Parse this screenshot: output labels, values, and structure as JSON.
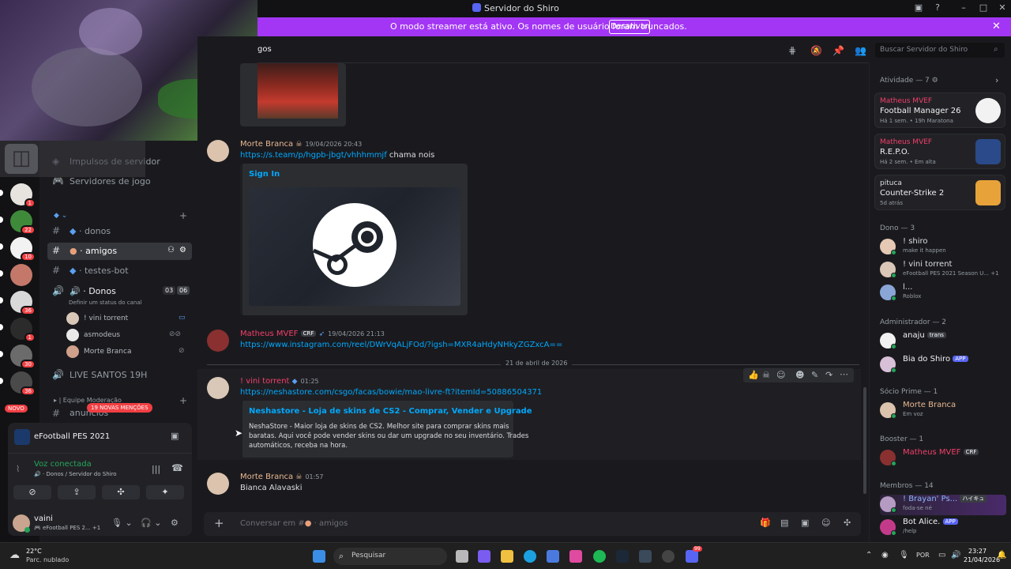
{
  "window": {
    "title": "Servidor do Shiro"
  },
  "streamer_banner": {
    "message": "O modo streamer está ativo. Os nomes de usuário foram truncados.",
    "button": "Desativar"
  },
  "server_rail": {
    "badges": [
      "1",
      "22",
      "10",
      "",
      "36",
      "1",
      "30",
      "36"
    ],
    "novo_label": "NOVO",
    "mentions_label": "19 NOVAS MENÇÕES"
  },
  "sidebar": {
    "top_items": [
      "Impulsos de servidor",
      "Servidores de jogo"
    ],
    "channels": [
      {
        "label": "donos",
        "prefix": "·"
      },
      {
        "label": "amigos",
        "prefix": "·"
      },
      {
        "label": "testes-bot",
        "prefix": "·"
      }
    ],
    "voice_channel": {
      "label": "Donos",
      "count_a": "03",
      "count_b": "06",
      "status_hint": "Definir um status do canal"
    },
    "voice_users": [
      "! vini torrent",
      "asmodeus",
      "Morte Branca"
    ],
    "other_channels": [
      "LIVE SANTOS 19H",
      "| Equipe Moderação",
      "anuncios"
    ]
  },
  "voice_panel": {
    "game": "eFootball PES 2021",
    "status": "Voz conectada",
    "location": "Donos / Servidor do Shiro",
    "user_name": "vaini",
    "user_activity": "eFootball PES 2...",
    "user_activity_extra": "+1"
  },
  "header": {
    "channel": "gos",
    "search_placeholder": "Buscar Servidor do Shiro"
  },
  "messages": [
    {
      "author": "Morte Branca",
      "time": "19/04/2026 20:43",
      "link": "https://s.team/p/hgpb-jbgt/vhhhmmjf",
      "text": " chama nois",
      "embed_title": "Sign In"
    },
    {
      "author": "Matheus MVEF",
      "tag": "CRF",
      "time": "19/04/2026 21:13",
      "link": "https://www.instagram.com/reel/DWrVqALjFOd/?igsh=MXR4aHdyNHkyZGZxcA=="
    },
    {
      "author": "! vini torrent",
      "time": "01:25",
      "link": "https://neshastore.com/csgo/facas/bowie/mao-livre-ft?itemId=50886504371",
      "embed_title": "Neshastore - Loja de skins de CS2 - Comprar, Vender e Upgrade",
      "embed_desc": [
        "NeshaStore - Maior loja de skins de CS2. Melhor site para comprar skins mais",
        "baratas. Aqui você pode vender skins ou dar um upgrade no seu inventário. Trades",
        "automáticos, receba na hora."
      ]
    },
    {
      "author": "Morte Branca",
      "time": "01:57",
      "text": "Bianca Alavaski"
    }
  ],
  "date_separator": "21 de abril de 2026",
  "composer": {
    "placeholder_prefix": "Conversar em #",
    "channel": "amigos"
  },
  "members": {
    "activity_header": "Atividade — 7",
    "activities": [
      {
        "user": "Matheus MVEF",
        "game": "Football Manager 26",
        "meta": "Há 1 sem.  •  19h Maratona"
      },
      {
        "user": "Matheus MVEF",
        "game": "R.E.P.O.",
        "meta": "Há 2 sem.  •  Em alta"
      },
      {
        "user": "pituca",
        "game": "Counter-Strike 2",
        "meta": "5d atrás"
      }
    ],
    "groups": [
      {
        "header": "Dono — 3",
        "members": [
          {
            "name": "! shiro",
            "sub": "make it happen"
          },
          {
            "name": "! vini torrent",
            "sub": "eFootball PES 2021 Season U...  +1"
          },
          {
            "name": "l...",
            "sub": "Roblox"
          }
        ]
      },
      {
        "header": "Administrador — 2",
        "members": [
          {
            "name": "anaju",
            "tag": "trans",
            "sub": ""
          },
          {
            "name": "Bia do Shiro",
            "tag": "APP",
            "sub": ""
          }
        ]
      },
      {
        "header": "Sócio Prime — 1",
        "members": [
          {
            "name": "Morte Branca",
            "sub": "Em voz"
          }
        ]
      },
      {
        "header": "Booster — 1",
        "members": [
          {
            "name": "Matheus MVEF",
            "tag": "CRF",
            "sub": ""
          }
        ]
      },
      {
        "header": "Membros — 14",
        "members": [
          {
            "name": "! Brayan' Ps...",
            "tag": "ハイキュ",
            "sub": "foda-se né"
          },
          {
            "name": "Bot Alice.",
            "tag": "APP",
            "sub": "/help"
          }
        ]
      }
    ]
  },
  "taskbar": {
    "weather_temp": "22°C",
    "weather_desc": "Parc. nublado",
    "search": "Pesquisar",
    "lang": "POR",
    "time": "23:27",
    "date": "21/04/2026",
    "notif_badge": "99"
  },
  "colors": {
    "accent": "#5865f2",
    "streamer": "#a336f5",
    "link": "#00a8fc",
    "danger": "#f23f43"
  }
}
